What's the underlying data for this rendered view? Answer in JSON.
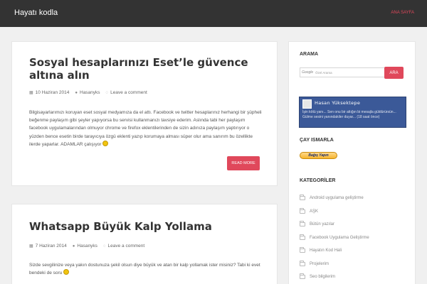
{
  "site": {
    "title": "Hayatı kodla"
  },
  "nav": {
    "home": "ANA SAYFA"
  },
  "posts": [
    {
      "title": "Sosyal hesaplarınızı Eset’le güvence altına alın",
      "date": "10 Haziran 2014",
      "author": "Hasanyks",
      "comment": "Leave a comment",
      "excerpt": "Bilgisayarlarımızı koruyan eset sosyal medyamıza da el attı. Facebook ve twitter hesaplarınız herhangi bir şüpheli beğenme paylaşım gibi şeyler yapıyorsa bu servisi kullanmanızı tavsiye ederim. Aslında tabi her paylaşım facebook uygulamalarından olmuyor chrome ve firefox eklentilerinden de sizin adınıza paylaşım yaptırıyor o yüzden bence esetin birde tarayıcıya özgü eklenti yazıp korumaya alması süper olur ama sanırım bu özellikte ilerde yaparlar. ADAMLAR çalışıyor",
      "read_more": "READ MORE"
    },
    {
      "title": "Whatsapp Büyük Kalp Yollama",
      "date": "7 Haziran 2014",
      "author": "Hasanyks",
      "comment": "Leave a comment",
      "excerpt": "Sizde sevgilinize veya yakın dostunuza şekil olsun diye büyük ve atan bir kalp yollamak ister misiniz? Tabi ki evet bendeki de soru"
    }
  ],
  "sidebar": {
    "search_title": "ARAMA",
    "search_logo": "Google",
    "search_placeholder": "Özel Arama",
    "search_button": "ARA",
    "fb_name": "Hasan Yüksektepe",
    "fb_message": "İşin kötü yanı... Sen onu bir attığın bi mesajla güldürürsün... Gülme sesini yanındakiler duyar... (18 saat önce)",
    "donate_title": "ÇAY ISMARLA",
    "donate_button": "Bağış Yapın",
    "categories_title": "KATEGORİLER",
    "categories": [
      "Android uygulama geliştirme",
      "AŞK",
      "Bütün yazılar",
      "Facebook Uygulama Geliştirme",
      "Hayatın Kod Hali",
      "Projelerim",
      "Seo bilgilerim"
    ]
  },
  "colors": {
    "accent": "#e0485b",
    "topbar": "#333333",
    "facebook": "#3b5998"
  },
  "icons": {
    "date": "calendar-icon",
    "author": "user-icon",
    "comment": "comment-icon",
    "category": "folder-icon"
  }
}
